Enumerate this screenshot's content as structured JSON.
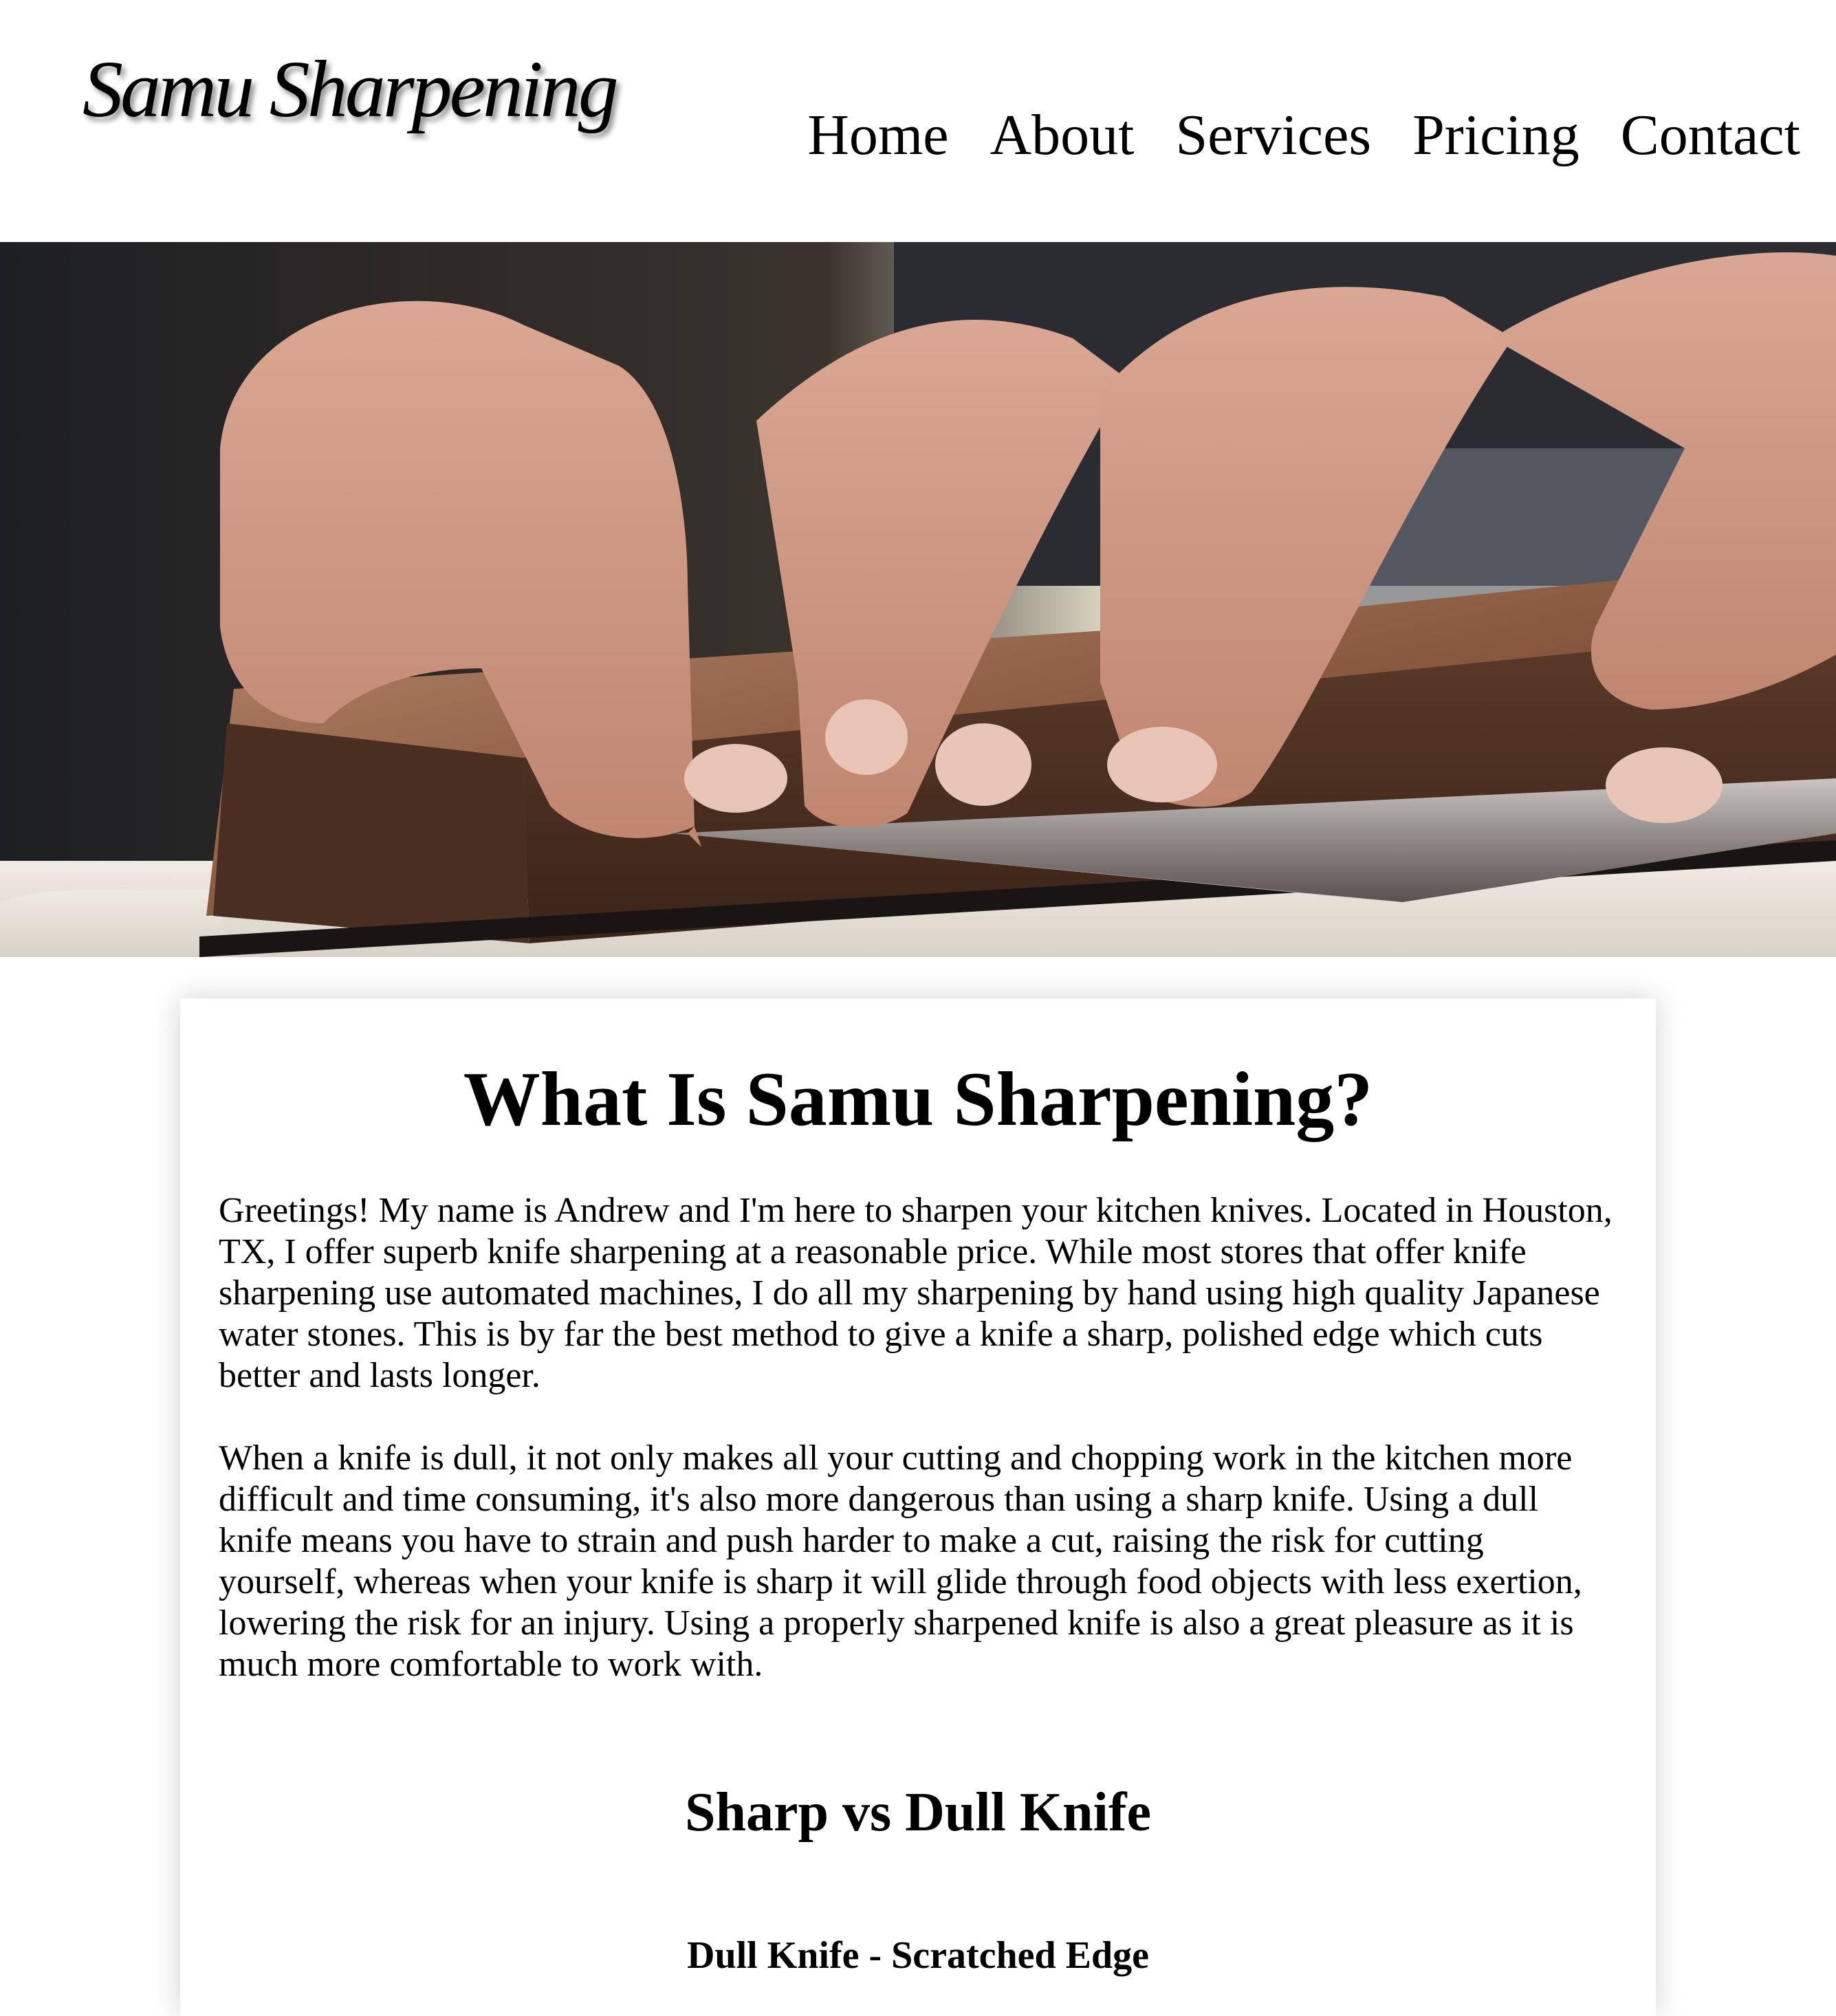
{
  "header": {
    "logo_text": "Samu Sharpening",
    "nav": [
      {
        "label": "Home"
      },
      {
        "label": "About"
      },
      {
        "label": "Services"
      },
      {
        "label": "Pricing"
      },
      {
        "label": "Contact"
      }
    ]
  },
  "hero": {
    "image": "hands-sharpening-knife-on-water-stone"
  },
  "main": {
    "title": "What Is Samu Sharpening?",
    "paragraph1": "Greetings! My name is Andrew and I'm here to sharpen your kitchen knives. Located in Houston, TX, I offer superb knife sharpening at a reasonable price. While most stores that offer knife sharpening use automated machines, I do all my sharpening by hand using high quality Japanese water stones. This is by far the best method to give a knife a sharp, polished edge which cuts better and lasts longer.",
    "paragraph2": "When a knife is dull, it not only makes all your cutting and chopping work in the kitchen more difficult and time consuming, it's also more dangerous than using a sharp knife. Using a dull knife means you have to strain and push harder to make a cut, raising the risk for cutting yourself, whereas when your knife is sharp it will glide through food objects with less exertion, lowering the risk for an injury. Using a properly sharpened knife is also a great pleasure as it is much more comfortable to work with.",
    "section_title": "Sharp vs Dull Knife",
    "subsection_title": "Dull Knife - Scratched Edge"
  }
}
